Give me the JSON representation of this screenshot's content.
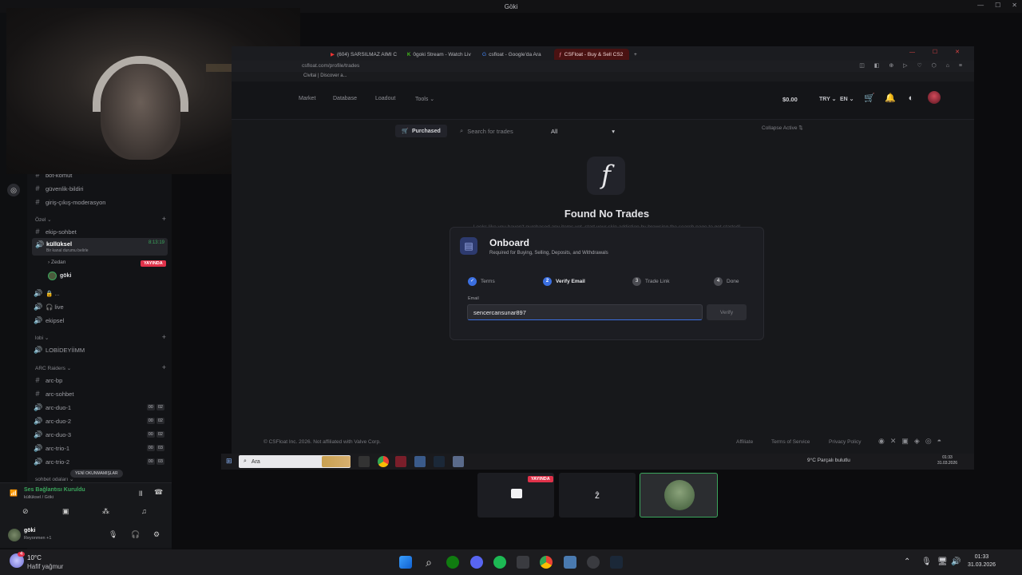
{
  "window": {
    "title": "Göki"
  },
  "discord": {
    "channels": {
      "items": [
        {
          "icon": "#",
          "label": "bot-komut"
        },
        {
          "icon": "#",
          "label": "güvenlik-bildiri"
        },
        {
          "icon": "#",
          "label": "giriş-çıkış-moderasyon"
        }
      ],
      "cat_ozel": "Özel",
      "ekip_sohbet": "ekip-sohbet",
      "voice_kulluksel": {
        "label": "küllüksel",
        "time": "8:13:19",
        "sub": "Bir kanal durumu belirle"
      },
      "member_zeden": "Zedan",
      "live_badge": "YAYINDA",
      "member_goki": "göki",
      "lock_ch": "🔒 ...",
      "live_ch": "🎧 live",
      "ekipsel": "ekipsel",
      "cat_lobi": "lobi",
      "lobideyiimm": "LOBİDEYİİMM",
      "cat_arc": "ARC Raiders",
      "arc_bp": "arc-bp",
      "arc_sohbet": "arc-sohbet",
      "arc_rooms": [
        {
          "label": "arc-duo-1",
          "a": "00",
          "b": "02"
        },
        {
          "label": "arc-duo-2",
          "a": "00",
          "b": "02"
        },
        {
          "label": "arc-duo-3",
          "a": "00",
          "b": "02"
        },
        {
          "label": "arc-trio-1",
          "a": "00",
          "b": "03"
        },
        {
          "label": "arc-trio-2",
          "a": "00",
          "b": "03"
        }
      ],
      "unread_pill": "YENİ OKUNMAMIŞLAR",
      "cat_sohbet": "sohbet odaları"
    },
    "voice": {
      "status": "Ses Bağlantısı Kuruldu",
      "channel": "küllüksel / Göki"
    },
    "user": {
      "name": "göki",
      "status": "Reyonmen +1"
    }
  },
  "browser": {
    "tabs": [
      {
        "label": "(604) SARSILMAZ AIMI C",
        "icon": "youtube"
      },
      {
        "label": "0goki Stream - Watch Liv",
        "icon": "kick"
      },
      {
        "label": "csfloat - Google'da Ara",
        "icon": "google"
      },
      {
        "label": "CSFloat - Buy & Sell CS2",
        "icon": "csfloat",
        "active": true
      }
    ],
    "address": "csfloat.com/profile/trades",
    "bookmark": "Civitai | Discover a..."
  },
  "csfloat": {
    "nav": {
      "market": "Market",
      "database": "Database",
      "loadout": "Loadout",
      "tools": "Tools"
    },
    "balance": "$0.00",
    "currency": "TRY",
    "lang": "EN",
    "filters": {
      "purchased": "Purchased",
      "search_placeholder": "Search for trades",
      "select": "All",
      "collapse": "Collapse Active"
    },
    "empty": {
      "title": "Found No Trades",
      "subtitle": "Looks like you haven't purchased any items yet, start your skin addiction by browsing the search page to get started!"
    },
    "modal": {
      "title": "Onboard",
      "subtitle": "Required for Buying, Selling, Deposits, and Withdrawals",
      "steps": [
        {
          "label": "Terms",
          "state": "done",
          "num": "✓"
        },
        {
          "label": "Verify Email",
          "state": "current",
          "num": "2"
        },
        {
          "label": "Trade Link",
          "state": "todo",
          "num": "3"
        },
        {
          "label": "Done",
          "state": "todo",
          "num": "4"
        }
      ],
      "email_label": "Email",
      "email_value": "sencercansunar897",
      "verify": "Verify"
    },
    "footer": {
      "copyright": "© CSFloat Inc. 2026. Not affiliated with Valve Corp.",
      "affiliate": "Affiliate",
      "terms": "Terms of Service",
      "privacy": "Privacy Policy"
    }
  },
  "inner_taskbar": {
    "search": "Ara",
    "weather": "9°C  Parçalı bulutlu",
    "time": "01:33",
    "date": "31.03.2026"
  },
  "thumbnails": {
    "live_badge": "YAYINDA",
    "middle_glyph": "ẑ"
  },
  "taskbar": {
    "weather_temp": "10°C",
    "weather_desc": "Hafif yağmur",
    "time": "01:33",
    "date": "31.03.2026",
    "badge": "4"
  }
}
